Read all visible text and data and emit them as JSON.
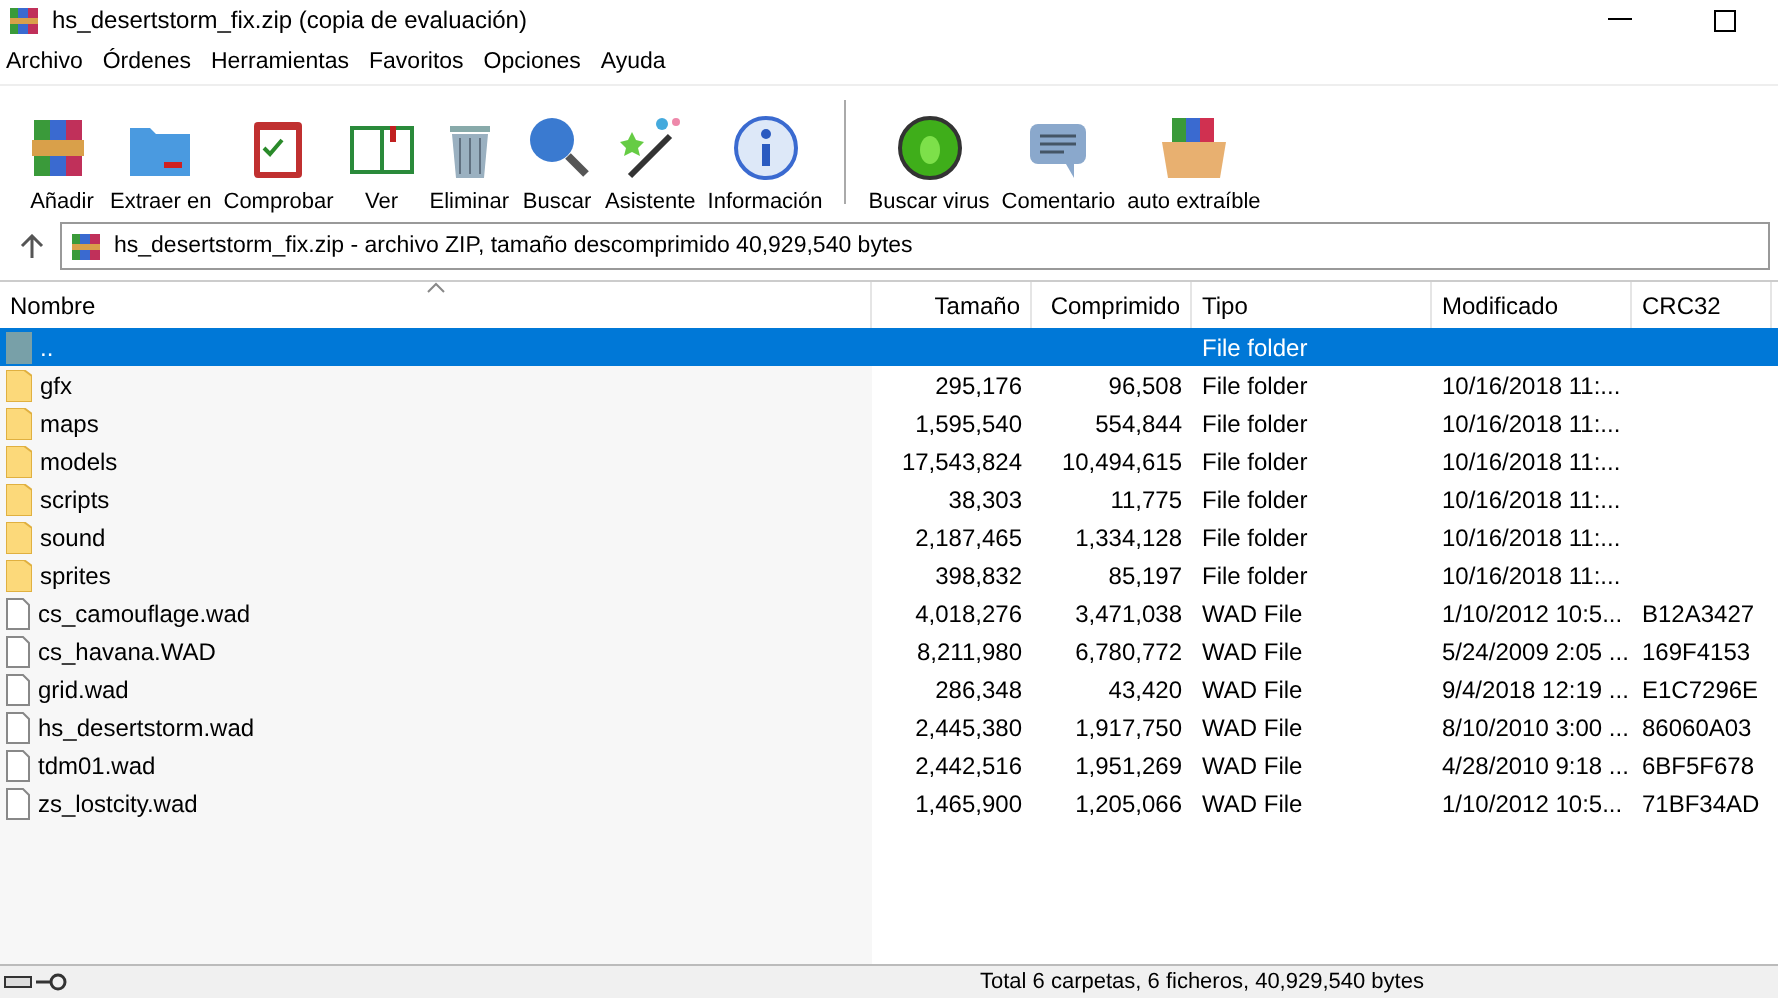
{
  "window": {
    "title": "hs_desertstorm_fix.zip (copia de evaluación)"
  },
  "menu": [
    "Archivo",
    "Órdenes",
    "Herramientas",
    "Favoritos",
    "Opciones",
    "Ayuda"
  ],
  "toolbar": [
    {
      "label": "Añadir"
    },
    {
      "label": "Extraer en"
    },
    {
      "label": "Comprobar"
    },
    {
      "label": "Ver"
    },
    {
      "label": "Eliminar"
    },
    {
      "label": "Buscar"
    },
    {
      "label": "Asistente"
    },
    {
      "label": "Información"
    },
    {
      "label": "Buscar virus"
    },
    {
      "label": "Comentario"
    },
    {
      "label": "auto extraíble"
    }
  ],
  "address": "hs_desertstorm_fix.zip - archivo ZIP, tamaño descomprimido 40,929,540 bytes",
  "columns": [
    {
      "label": "Nombre",
      "sorted": true
    },
    {
      "label": "Tamaño",
      "sorted": false
    },
    {
      "label": "Comprimido",
      "sorted": false
    },
    {
      "label": "Tipo",
      "sorted": false
    },
    {
      "label": "Modificado",
      "sorted": false
    },
    {
      "label": "CRC32",
      "sorted": false
    }
  ],
  "rows": [
    {
      "kind": "parent",
      "selected": true,
      "cells": [
        "..",
        "",
        "",
        "File folder",
        "",
        ""
      ]
    },
    {
      "kind": "folder",
      "selected": false,
      "cells": [
        "gfx",
        "295,176",
        "96,508",
        "File folder",
        "10/16/2018 11:...",
        ""
      ]
    },
    {
      "kind": "folder",
      "selected": false,
      "cells": [
        "maps",
        "1,595,540",
        "554,844",
        "File folder",
        "10/16/2018 11:...",
        ""
      ]
    },
    {
      "kind": "folder",
      "selected": false,
      "cells": [
        "models",
        "17,543,824",
        "10,494,615",
        "File folder",
        "10/16/2018 11:...",
        ""
      ]
    },
    {
      "kind": "folder",
      "selected": false,
      "cells": [
        "scripts",
        "38,303",
        "11,775",
        "File folder",
        "10/16/2018 11:...",
        ""
      ]
    },
    {
      "kind": "folder",
      "selected": false,
      "cells": [
        "sound",
        "2,187,465",
        "1,334,128",
        "File folder",
        "10/16/2018 11:...",
        ""
      ]
    },
    {
      "kind": "folder",
      "selected": false,
      "cells": [
        "sprites",
        "398,832",
        "85,197",
        "File folder",
        "10/16/2018 11:...",
        ""
      ]
    },
    {
      "kind": "file",
      "selected": false,
      "cells": [
        "cs_camouflage.wad",
        "4,018,276",
        "3,471,038",
        "WAD File",
        "1/10/2012 10:5...",
        "B12A3427"
      ]
    },
    {
      "kind": "file",
      "selected": false,
      "cells": [
        "cs_havana.WAD",
        "8,211,980",
        "6,780,772",
        "WAD File",
        "5/24/2009 2:05 ...",
        "169F4153"
      ]
    },
    {
      "kind": "file",
      "selected": false,
      "cells": [
        "grid.wad",
        "286,348",
        "43,420",
        "WAD File",
        "9/4/2018 12:19 ...",
        "E1C7296E"
      ]
    },
    {
      "kind": "file",
      "selected": false,
      "cells": [
        "hs_desertstorm.wad",
        "2,445,380",
        "1,917,750",
        "WAD File",
        "8/10/2010 3:00 ...",
        "86060A03"
      ]
    },
    {
      "kind": "file",
      "selected": false,
      "cells": [
        "tdm01.wad",
        "2,442,516",
        "1,951,269",
        "WAD File",
        "4/28/2010 9:18 ...",
        "6BF5F678"
      ]
    },
    {
      "kind": "file",
      "selected": false,
      "cells": [
        "zs_lostcity.wad",
        "1,465,900",
        "1,205,066",
        "WAD File",
        "1/10/2012 10:5...",
        "71BF34AD"
      ]
    }
  ],
  "status": "Total 6 carpetas, 6 ficheros, 40,929,540 bytes"
}
